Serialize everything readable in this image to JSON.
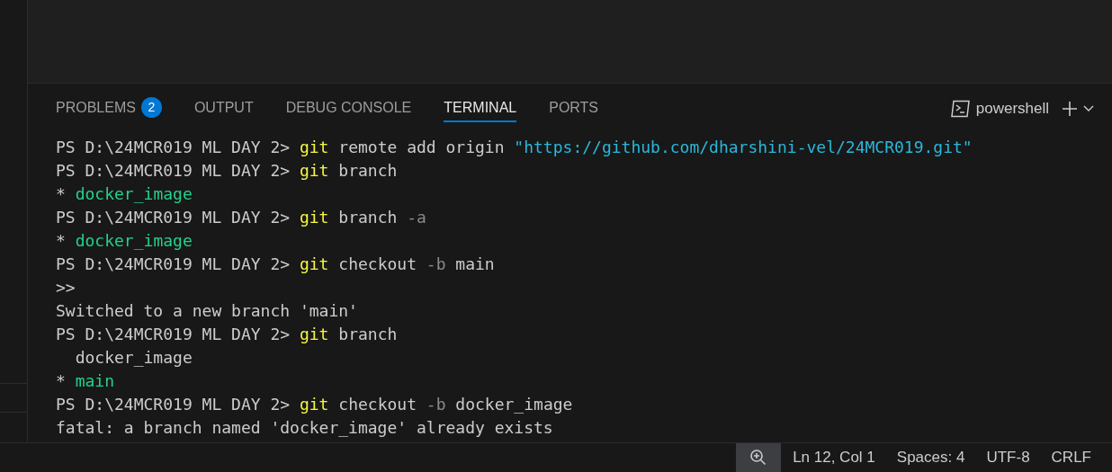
{
  "panel": {
    "tabs": [
      {
        "label": "PROBLEMS",
        "selected": false,
        "badge": "2"
      },
      {
        "label": "OUTPUT",
        "selected": false
      },
      {
        "label": "DEBUG CONSOLE",
        "selected": false
      },
      {
        "label": "TERMINAL",
        "selected": true
      },
      {
        "label": "PORTS",
        "selected": false
      }
    ],
    "terminal_name": "powershell"
  },
  "terminal": {
    "lines": [
      [
        {
          "kind": "prompt",
          "text": "PS D:\\24MCR019 ML DAY 2> "
        },
        {
          "kind": "command",
          "text": "git"
        },
        {
          "kind": "text",
          "text": " remote add origin "
        },
        {
          "kind": "string",
          "text": "\"https://github.com/dharshini-vel/24MCR019.git\""
        }
      ],
      [
        {
          "kind": "prompt",
          "text": "PS D:\\24MCR019 ML DAY 2> "
        },
        {
          "kind": "command",
          "text": "git"
        },
        {
          "kind": "text",
          "text": " branch"
        }
      ],
      [
        {
          "kind": "text",
          "text": "* "
        },
        {
          "kind": "branch",
          "text": "docker_image"
        }
      ],
      [
        {
          "kind": "prompt",
          "text": "PS D:\\24MCR019 ML DAY 2> "
        },
        {
          "kind": "command",
          "text": "git"
        },
        {
          "kind": "text",
          "text": " branch "
        },
        {
          "kind": "flag",
          "text": "-a"
        }
      ],
      [
        {
          "kind": "text",
          "text": "* "
        },
        {
          "kind": "branch",
          "text": "docker_image"
        }
      ],
      [
        {
          "kind": "prompt",
          "text": "PS D:\\24MCR019 ML DAY 2> "
        },
        {
          "kind": "command",
          "text": "git"
        },
        {
          "kind": "text",
          "text": " checkout "
        },
        {
          "kind": "flag",
          "text": "-b"
        },
        {
          "kind": "text",
          "text": " main"
        }
      ],
      [
        {
          "kind": "text",
          "text": ">>"
        }
      ],
      [
        {
          "kind": "text",
          "text": "Switched to a new branch 'main'"
        }
      ],
      [
        {
          "kind": "prompt",
          "text": "PS D:\\24MCR019 ML DAY 2> "
        },
        {
          "kind": "command",
          "text": "git"
        },
        {
          "kind": "text",
          "text": " branch"
        }
      ],
      [
        {
          "kind": "text",
          "text": "  docker_image"
        }
      ],
      [
        {
          "kind": "text",
          "text": "* "
        },
        {
          "kind": "branch",
          "text": "main"
        }
      ],
      [
        {
          "kind": "prompt",
          "text": "PS D:\\24MCR019 ML DAY 2> "
        },
        {
          "kind": "command",
          "text": "git"
        },
        {
          "kind": "text",
          "text": " checkout "
        },
        {
          "kind": "flag",
          "text": "-b"
        },
        {
          "kind": "text",
          "text": " docker_image"
        }
      ],
      [
        {
          "kind": "text",
          "text": "fatal: a branch named 'docker_image' already exists"
        }
      ]
    ]
  },
  "status_bar": {
    "items": [
      "Ln 12, Col 1",
      "Spaces: 4",
      "UTF-8",
      "CRLF"
    ]
  }
}
